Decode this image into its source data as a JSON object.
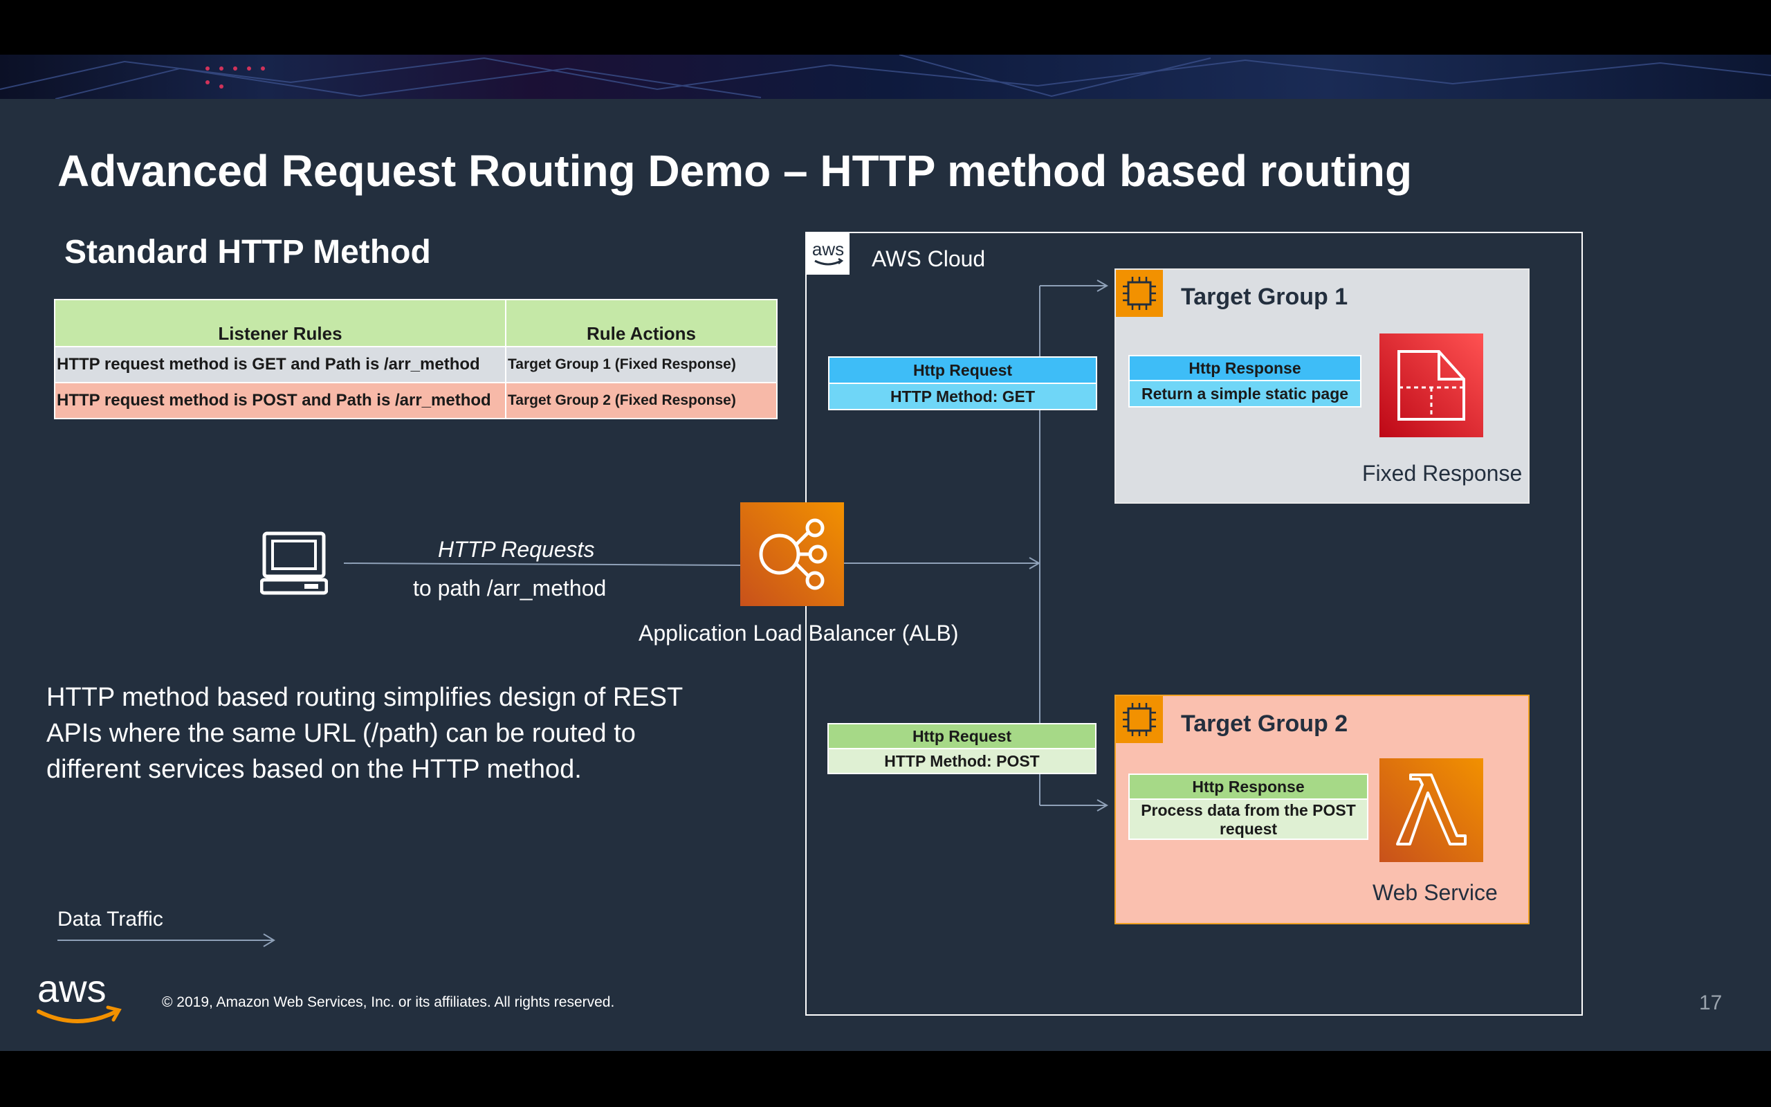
{
  "slide": {
    "title": "Advanced Request Routing Demo – HTTP method based routing",
    "subtitle": "Standard HTTP Method",
    "page_number": "17",
    "copyright": "© 2019, Amazon Web Services, Inc. or its affiliates. All rights reserved.",
    "body_text": "HTTP method based routing simplifies design of REST APIs where the same URL (/path) can be routed to different services based on the HTTP method.",
    "legend_label": "Data Traffic",
    "aws_logo_text": "aws"
  },
  "rules_table": {
    "headers": [
      "Listener Rules",
      "Rule Actions"
    ],
    "rows": [
      {
        "rule": "HTTP request method is GET and Path is /arr_method",
        "action": "Target Group 1 (Fixed Response)"
      },
      {
        "rule": "HTTP request method is POST and Path is /arr_method",
        "action": "Target Group 2 (Fixed Response)"
      }
    ]
  },
  "diagram": {
    "cloud_label": "AWS Cloud",
    "cloud_badge_text": "aws",
    "client_icon": "laptop-icon",
    "flow_label_1": "HTTP Requests",
    "flow_label_2": "to path /arr_method",
    "alb_label": "Application Load Balancer (ALB)",
    "get_request": {
      "head": "Http Request",
      "sub": "HTTP Method: GET"
    },
    "post_request": {
      "head": "Http Request",
      "sub": "HTTP Method: POST"
    },
    "target_group_1": {
      "title": "Target Group 1",
      "response_head": "Http Response",
      "response_sub": "Return a simple static page",
      "service_label": "Fixed Response"
    },
    "target_group_2": {
      "title": "Target Group 2",
      "response_head": "Http Response",
      "response_sub": "Process data from the POST request",
      "service_label": "Web Service"
    }
  },
  "colors": {
    "slide_bg": "#232f3e",
    "aws_orange": "#f29100",
    "get_blue": "#3ebdf7",
    "get_sub_blue": "#6fd6f7",
    "post_green": "#a6d987",
    "post_sub_green": "#dff0d3",
    "tg1_bg": "#dbdee2",
    "tg2_bg": "#fac0af",
    "fixed_red": "#d8232a",
    "header_green": "#c5e8a7",
    "row_gray": "#d9dde2",
    "row_pink": "#f7b9a8"
  }
}
